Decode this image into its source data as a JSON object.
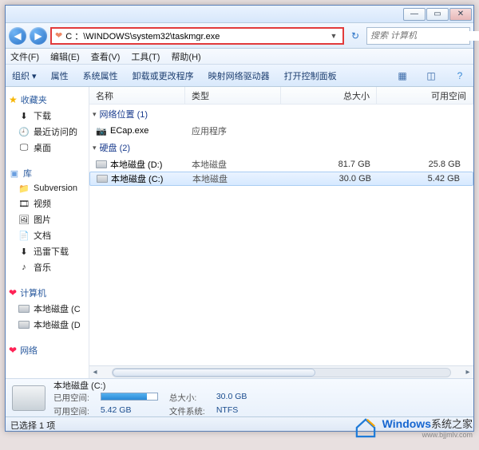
{
  "titlebar": {
    "min": "—",
    "max": "▭",
    "close": "✕"
  },
  "nav": {
    "address": "C ：\\WINDOWS\\system32\\taskmgr.exe",
    "search_placeholder": "搜索 计算机"
  },
  "menu": {
    "file": "文件(F)",
    "edit": "编辑(E)",
    "view": "查看(V)",
    "tools": "工具(T)",
    "help": "帮助(H)"
  },
  "toolbar": {
    "organize": "组织 ▾",
    "properties": "属性",
    "sysprops": "系统属性",
    "uninstall": "卸载或更改程序",
    "mapdrive": "映射网络驱动器",
    "controlpanel": "打开控制面板"
  },
  "columns": {
    "name": "名称",
    "type": "类型",
    "total": "总大小",
    "free": "可用空间"
  },
  "groups": {
    "net": {
      "label": "网络位置 (1)",
      "items": [
        {
          "name": "ECap.exe",
          "type": "应用程序"
        }
      ]
    },
    "disk": {
      "label": "硬盘 (2)",
      "items": [
        {
          "name": "本地磁盘 (D:)",
          "type": "本地磁盘",
          "total": "81.7 GB",
          "free": "25.8 GB"
        },
        {
          "name": "本地磁盘 (C:)",
          "type": "本地磁盘",
          "total": "30.0 GB",
          "free": "5.42 GB"
        }
      ]
    }
  },
  "sidebar": {
    "favorites": {
      "label": "收藏夹",
      "items": [
        "下载",
        "最近访问的",
        "桌面"
      ]
    },
    "library": {
      "label": "库",
      "items": [
        "Subversion",
        "视频",
        "图片",
        "文档",
        "迅雷下载",
        "音乐"
      ]
    },
    "computer": {
      "label": "计算机",
      "items": [
        "本地磁盘 (C",
        "本地磁盘 (D"
      ]
    },
    "network": {
      "label": "网络"
    }
  },
  "details": {
    "title": "本地磁盘 (C:)",
    "used_label": "已用空间:",
    "free_label": "可用空间:",
    "free_val": "5.42 GB",
    "total_label": "总大小:",
    "total_val": "30.0 GB",
    "fs_label": "文件系统:",
    "fs_val": "NTFS"
  },
  "status": "已选择 1 项",
  "watermark": {
    "brand": "Windows",
    "suffix": "系统之家",
    "url": "www.bjjmlv.com"
  }
}
